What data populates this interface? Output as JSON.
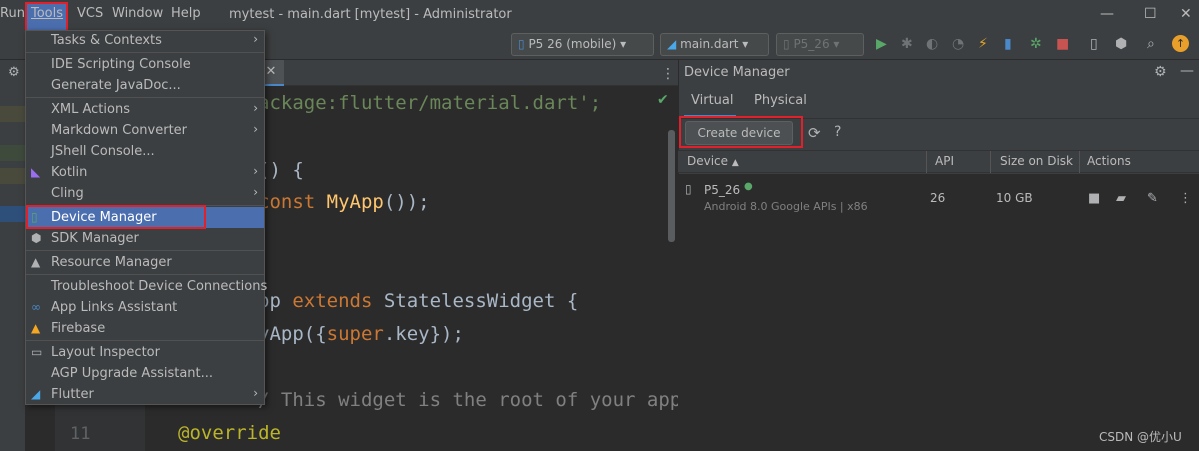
{
  "menubar": {
    "items": [
      {
        "label": "Run",
        "mnemonic_rest": "un",
        "mnemonic": "R"
      },
      {
        "label": "Tools"
      },
      {
        "label": "VCS"
      },
      {
        "label": "Window"
      },
      {
        "label": "Help"
      }
    ],
    "title": "mytest - main.dart [mytest] - Administrator",
    "minimize": "—",
    "maximize": "☐",
    "close": "✕"
  },
  "toolbar": {
    "device_select": "P5 26 (mobile)",
    "config_select": "main.dart",
    "target_select": "P5_26"
  },
  "tools_menu": {
    "items": [
      {
        "label": "Tasks & Contexts",
        "submenu": true
      },
      {
        "label": "IDE Scripting Console"
      },
      {
        "label": "Generate JavaDoc..."
      },
      {
        "label": "XML Actions",
        "submenu": true
      },
      {
        "label": "Markdown Converter",
        "submenu": true
      },
      {
        "label": "JShell Console..."
      },
      {
        "label": "Kotlin",
        "submenu": true
      },
      {
        "label": "Cling",
        "submenu": true
      },
      {
        "label": "Device Manager",
        "selected": true
      },
      {
        "label": "SDK Manager"
      },
      {
        "label": "Resource Manager"
      },
      {
        "label": "Troubleshoot Device Connections"
      },
      {
        "label": "App Links Assistant"
      },
      {
        "label": "Firebase"
      },
      {
        "label": "Layout Inspector"
      },
      {
        "label": "AGP Upgrade Assistant..."
      },
      {
        "label": "Flutter",
        "submenu": true
      }
    ],
    "submenu_arrow": "›"
  },
  "editor": {
    "line_numbers": [
      "11"
    ],
    "code": {
      "l1_str": "ackage:flutter/material.dart';",
      "l3": "() {",
      "l4_kw": "const ",
      "l4_fn": "MyApp",
      "l4_rest": "());",
      "l7_a": "pp ",
      "l7_kw": "extends ",
      "l7_b": "StatelessWidget {",
      "l8_a": "yApp({",
      "l8_kw": "super",
      "l8_b": ".key});",
      "l10": "/ This widget is the root of your applica",
      "l11": "@override"
    }
  },
  "device_manager": {
    "title": "Device Manager",
    "tabs": [
      "Virtual",
      "Physical"
    ],
    "create_button": "Create device",
    "columns": {
      "device": "Device",
      "api": "API",
      "size": "Size on Disk",
      "actions": "Actions"
    },
    "devices": [
      {
        "name": "P5_26",
        "subtitle": "Android 8.0 Google APIs | x86",
        "api": "26",
        "size": "10 GB",
        "online": true
      }
    ]
  },
  "watermark": "CSDN @优小U",
  "colors": {
    "accent": "#4b6eaf",
    "highlight_box": "#e0202a",
    "status_online": "#59a869"
  }
}
